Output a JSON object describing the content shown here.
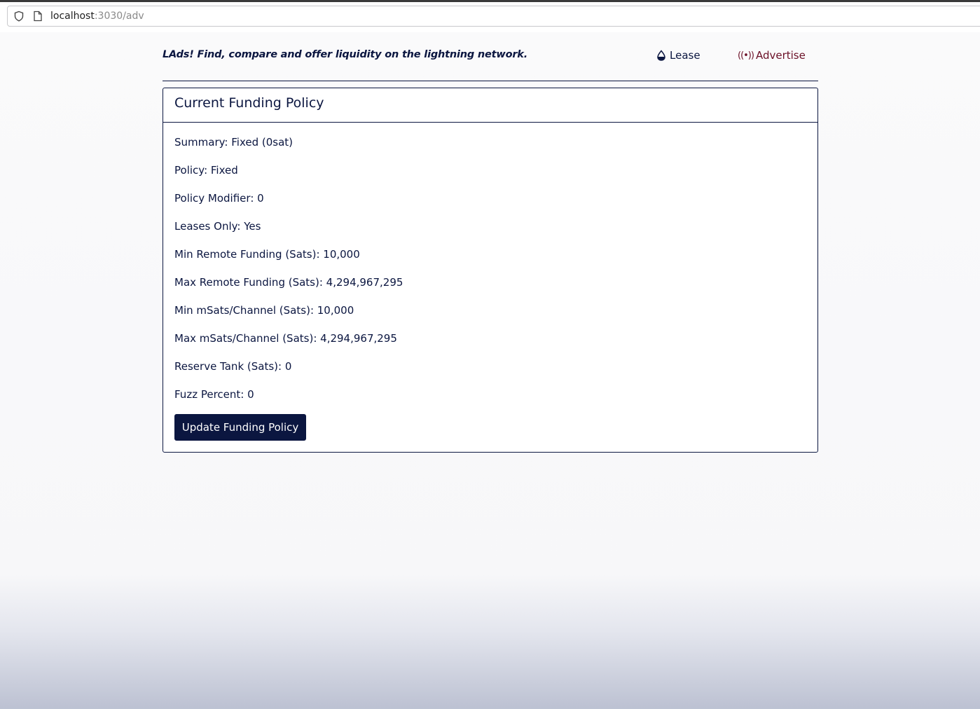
{
  "browser": {
    "url_host": "localhost",
    "url_rest": ":3030/adv"
  },
  "header": {
    "tagline": "LAds! Find, compare and offer liquidity on the lightning network.",
    "nav": {
      "lease": "Lease",
      "advertise": "Advertise",
      "lease_icon": "droplet-icon",
      "advertise_icon": "broadcast-icon",
      "advertise_color": "#6b1027"
    }
  },
  "card": {
    "title": "Current Funding Policy",
    "rows": [
      {
        "label": "Summary",
        "value": "Fixed (0sat)"
      },
      {
        "label": "Policy",
        "value": "Fixed"
      },
      {
        "label": "Policy Modifier",
        "value": "0"
      },
      {
        "label": "Leases Only",
        "value": "Yes"
      },
      {
        "label": "Min Remote Funding (Sats)",
        "value": "10,000"
      },
      {
        "label": "Max Remote Funding (Sats)",
        "value": "4,294,967,295"
      },
      {
        "label": "Min mSats/Channel (Sats)",
        "value": "10,000"
      },
      {
        "label": "Max mSats/Channel (Sats)",
        "value": "4,294,967,295"
      },
      {
        "label": "Reserve Tank (Sats)",
        "value": "0"
      },
      {
        "label": "Fuzz Percent",
        "value": "0"
      }
    ],
    "button_label": "Update Funding Policy"
  },
  "colors": {
    "primary": "#0b1640",
    "accent": "#6b1027"
  }
}
